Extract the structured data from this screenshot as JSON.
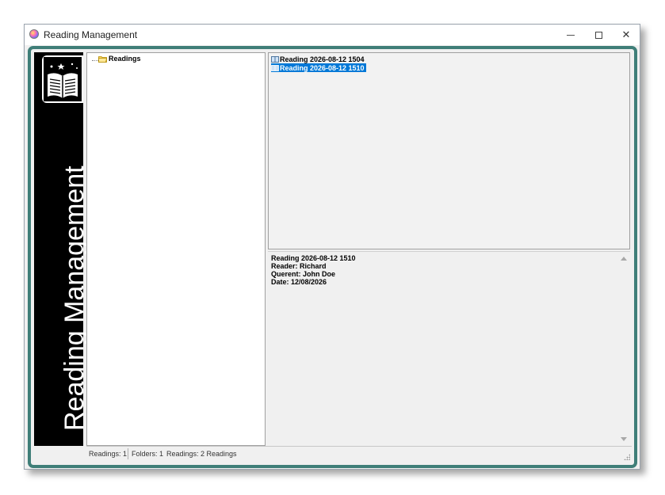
{
  "window": {
    "title": "Reading Management"
  },
  "banner": {
    "text": "Reading Management"
  },
  "tree": {
    "root_label": "Readings"
  },
  "list": {
    "items": [
      {
        "label": "Reading 2026-08-12 1504",
        "selected": false
      },
      {
        "label": "Reading 2026-08-12 1510",
        "selected": true
      }
    ]
  },
  "details": {
    "title": "Reading 2026-08-12 1510",
    "reader": "Reader: Richard",
    "querent": "Querent: John Doe",
    "date": "Date: 12/08/2026"
  },
  "status": {
    "readings_count": "Readings: 1",
    "folders_count": "Folders: 1",
    "readings_summary": "Readings: 2 Readings"
  },
  "colors": {
    "frame": "#3f7e78",
    "selection": "#0078d7",
    "banner_bg": "#000000"
  }
}
